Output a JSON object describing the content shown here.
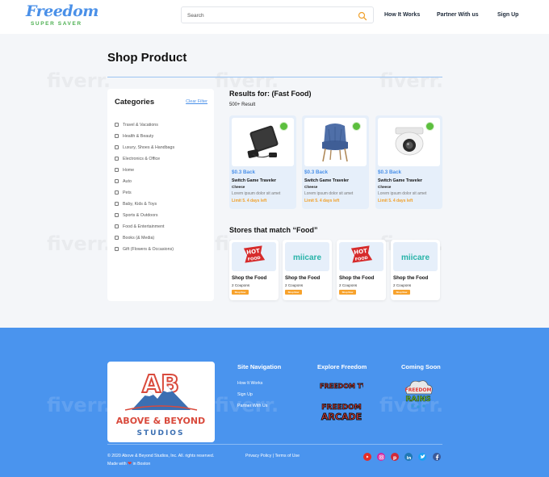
{
  "header": {
    "logo_title": "Freedom",
    "logo_subtitle": "SUPER SAVER",
    "search_placeholder": "Search",
    "nav": [
      "How It Works",
      "Partner With us",
      "Sign Up"
    ]
  },
  "page_title": "Shop Product",
  "watermark": "fiverr.",
  "sidebar": {
    "title": "Categories",
    "clear_label": "Clear Filter",
    "categories": [
      "Travel & Vacations",
      "Health & Beauty",
      "Luxury, Shoes & Handbags",
      "Electronics & Office",
      "Home",
      "Auto",
      "Pets",
      "Baby, Kids & Toys",
      "Sports & Outdoors",
      "Food & Entertainment",
      "Books (& Media)",
      "Gift (Flowers & Occasions)"
    ]
  },
  "results": {
    "title": "Results for: (Fast Food)",
    "count": "500+ Result",
    "products": [
      {
        "image": "game-console-icon",
        "cashback": "$0.3 Back",
        "name": "Switch Game Traveler",
        "sub": "Cheese",
        "desc": "Lorem ipsum dolor sit amet",
        "limit": "Limit 5. 4 days left"
      },
      {
        "image": "armchair-icon",
        "cashback": "$0.3 Back",
        "name": "Switch Game Traveler",
        "sub": "Cheese",
        "desc": "Lorem ipsum dolor sit amet",
        "limit": "Limit 5. 4 days left"
      },
      {
        "image": "security-camera-icon",
        "cashback": "$0.3 Back",
        "name": "Switch Game Traveler",
        "sub": "Cheese",
        "desc": "Lorem ipsum dolor sit amet",
        "limit": "Limit 5. 4 days left"
      }
    ]
  },
  "stores": {
    "title": "Stores that match “Food”",
    "items": [
      {
        "logo": "hot-food-logo",
        "logo_top": "HOT",
        "logo_bottom": "FOOD",
        "name": "Shop the Food",
        "coupons": "2 Coupons",
        "button": "Shop Now"
      },
      {
        "logo": "miicare-logo",
        "logo_text": "miicare",
        "name": "Shop the Food",
        "coupons": "2 Coupons",
        "button": "Shop Now"
      },
      {
        "logo": "hot-food-logo",
        "logo_top": "HOT",
        "logo_bottom": "FOOD",
        "name": "Shop the Food",
        "coupons": "2 Coupons",
        "button": "Shop Now"
      },
      {
        "logo": "miicare-logo",
        "logo_text": "miicare",
        "name": "Shop the Food",
        "coupons": "2 Coupons",
        "button": "Shop Now"
      }
    ]
  },
  "footer": {
    "brand_line1": "ABOVE & BEYOND",
    "brand_line2": "STUDIOS",
    "brand_monogram": "AB",
    "site_nav_title": "Site Navigation",
    "site_nav_links": [
      "How It Works",
      "Sign Up",
      "Partner With Us"
    ],
    "explore_title": "Explore Freedom",
    "explore_logos": [
      {
        "name": "freedom-tv-logo",
        "text": "FREEDOM TV"
      },
      {
        "name": "freedom-arcade-logo",
        "top": "FREEDOM",
        "bottom": "ARCADE"
      }
    ],
    "coming_title": "Coming Soon",
    "coming_logo": {
      "top": "FREEDOM",
      "bottom": "RAINS"
    },
    "copyright": "© 2020 Above & Beyond Studios, Inc. All. rights reserved.",
    "made_with_prefix": "Made with",
    "made_with_suffix": "in Boston",
    "privacy": "Privacy Policy",
    "separator": "|",
    "terms": "Terms of Use",
    "social": [
      "youtube-icon",
      "instagram-icon",
      "pinterest-icon",
      "linkedin-icon",
      "twitter-icon",
      "facebook-icon"
    ]
  },
  "colors": {
    "accent": "#4a90e8",
    "footer_bg": "#4a94ee",
    "cashback": "#4a90e8",
    "limit": "#f0a02a",
    "button": "#f7a22c",
    "badge": "#5cbf3e"
  }
}
